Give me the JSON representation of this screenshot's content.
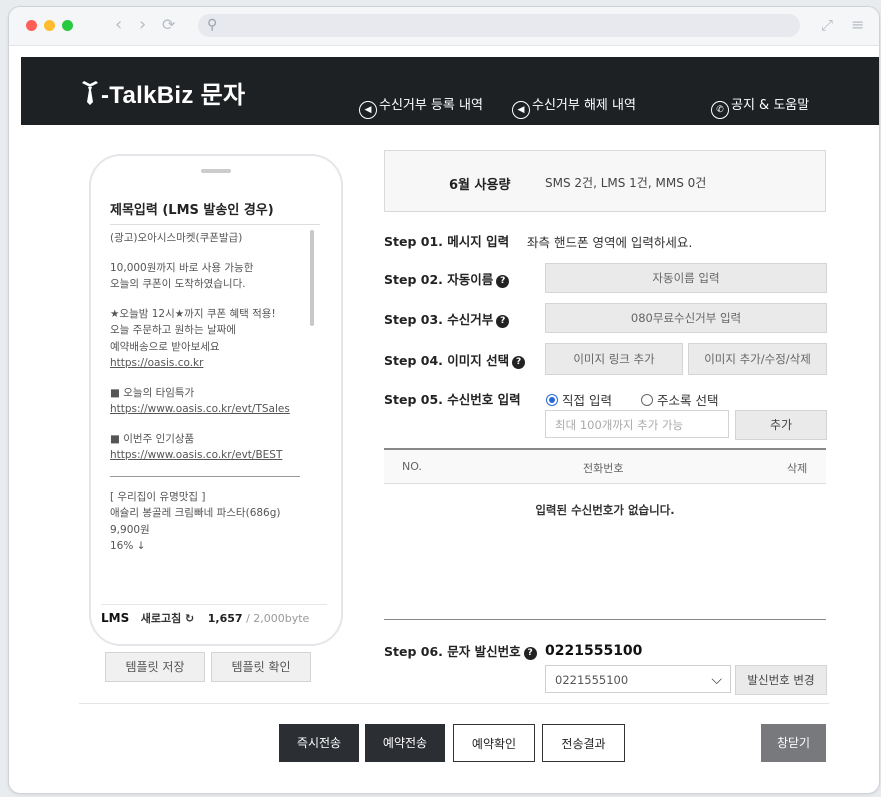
{
  "window": {
    "dot_colors": [
      "#ff5f57",
      "#febc2e",
      "#28c840"
    ],
    "url": ""
  },
  "header": {
    "logo_text": "-TalkBiz 문자",
    "nav": [
      {
        "label": "수신거부 등록 내역",
        "icon": "speaker-icon"
      },
      {
        "label": "수신거부 해제 내역",
        "icon": "speaker-icon"
      },
      {
        "label": "공지 & 도움말",
        "icon": "phone-icon"
      }
    ]
  },
  "phone": {
    "title": "제목입력 (LMS 발송인 경우)",
    "message_lines": [
      "(광고)오아시스마켓(쿠폰발급)",
      "10,000원까지 바로 사용 가능한",
      "오늘의 쿠폰이 도착하였습니다.",
      "★오늘밤 12시★까지 쿠폰 혜택 적용!",
      "오늘 주문하고 원하는 날짜에",
      "예약배송으로 받아보세요",
      "https://oasis.co.kr",
      "■ 오늘의 타임특가",
      "https://www.oasis.co.kr/evt/TSales",
      "■ 이번주 인기상품",
      "https://www.oasis.co.kr/evt/BEST",
      "[ 우리집이 유명맛집 ]",
      "애슐리 봉골레 크림빠네 파스타(686g)",
      "9,900원",
      "16% ↓"
    ],
    "msg_type": "LMS",
    "refresh_label": "새로고침",
    "byte_count": "1,657",
    "byte_limit": "/ 2,000byte"
  },
  "template_buttons": {
    "save": "템플릿 저장",
    "check": "템플릿 확인"
  },
  "usage": {
    "label": "6월 사용량",
    "value": "SMS 2건,  LMS 1건,  MMS 0건"
  },
  "steps": {
    "s1": {
      "label": "Step 01. 메시지 입력",
      "desc": "좌측 핸드폰 영역에 입력하세요."
    },
    "s2": {
      "label": "Step 02. 자동이름",
      "button": "자동이름 입력"
    },
    "s3": {
      "label": "Step 03. 수신거부",
      "button": "080무료수신거부 입력"
    },
    "s4": {
      "label": "Step 04. 이미지 선택",
      "button_link": "이미지 링크 추가",
      "button_add": "이미지 추가/수정/삭제"
    },
    "s5": {
      "label": "Step 05. 수신번호 입력",
      "radio_direct": "직접 입력",
      "radio_book": "주소록 선택",
      "selected": "직접 입력",
      "input_placeholder": "최대 100개까지 추가 가능",
      "add_button": "추가",
      "table_headers": [
        "NO.",
        "전화번호",
        "삭제"
      ],
      "empty_text": "입력된 수신번호가 없습니다."
    },
    "s6": {
      "label": "Step 06. 문자 발신번호",
      "number": "0221555100",
      "select_value": "0221555100",
      "change_button": "발신번호 변경"
    }
  },
  "footer": {
    "send_now": "즉시전송",
    "reserve": "예약전송",
    "reserve_check": "예약확인",
    "result": "전송결과",
    "close": "창닫기"
  }
}
